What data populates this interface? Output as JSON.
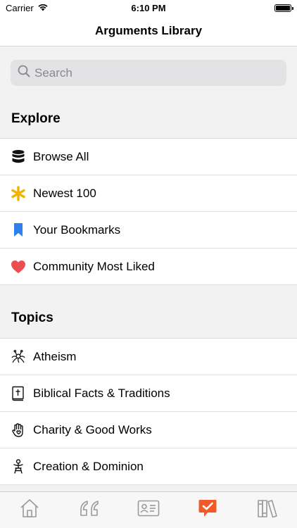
{
  "status": {
    "carrier": "Carrier",
    "time": "6:10 PM"
  },
  "nav": {
    "title": "Arguments Library"
  },
  "search": {
    "placeholder": "Search"
  },
  "explore": {
    "header": "Explore",
    "items": [
      {
        "label": "Browse All",
        "icon": "database-icon"
      },
      {
        "label": "Newest 100",
        "icon": "asterisk-icon"
      },
      {
        "label": "Your Bookmarks",
        "icon": "bookmark-icon"
      },
      {
        "label": "Community Most Liked",
        "icon": "heart-icon"
      }
    ]
  },
  "topics": {
    "header": "Topics",
    "items": [
      {
        "label": "Atheism",
        "icon": "flying-spaghetti-monster-icon"
      },
      {
        "label": "Biblical Facts & Traditions",
        "icon": "bible-icon"
      },
      {
        "label": "Charity & Good Works",
        "icon": "hand-heart-icon"
      },
      {
        "label": "Creation & Dominion",
        "icon": "person-icon"
      }
    ]
  },
  "tabs": [
    {
      "icon": "home-icon",
      "active": false
    },
    {
      "icon": "quote-icon",
      "active": false
    },
    {
      "icon": "id-card-icon",
      "active": false
    },
    {
      "icon": "checkmark-speech-icon",
      "active": true
    },
    {
      "icon": "library-icon",
      "active": false
    }
  ],
  "colors": {
    "accent": "#f05a28",
    "bookmark": "#2f80ed",
    "heart": "#eb4e52",
    "asterisk": "#f2b200",
    "inactive_tab": "#9a9a9a"
  }
}
